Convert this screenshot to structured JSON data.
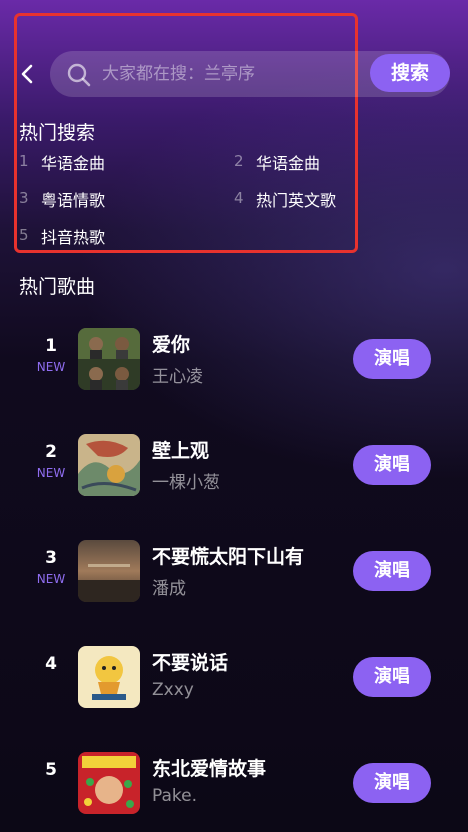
{
  "search": {
    "placeholder": "大家都在搜：兰亭序",
    "button_label": "搜索"
  },
  "hot_search": {
    "title": "热门搜索",
    "items": [
      {
        "rank": "1",
        "term": "华语金曲"
      },
      {
        "rank": "2",
        "term": "华语金曲"
      },
      {
        "rank": "3",
        "term": "粤语情歌"
      },
      {
        "rank": "4",
        "term": "热门英文歌"
      },
      {
        "rank": "5",
        "term": "抖音热歌"
      }
    ]
  },
  "hot_songs": {
    "title": "热门歌曲",
    "sing_label": "演唱",
    "items": [
      {
        "rank": "1",
        "badge": "NEW",
        "title": "爱你",
        "artist": "王心凌"
      },
      {
        "rank": "2",
        "badge": "NEW",
        "title": "壁上观",
        "artist": "一棵小葱"
      },
      {
        "rank": "3",
        "badge": "NEW",
        "title": "不要慌太阳下山有",
        "artist": "潘成"
      },
      {
        "rank": "4",
        "badge": "",
        "title": "不要说话",
        "artist": "Zxxy"
      },
      {
        "rank": "5",
        "badge": "",
        "title": "东北爱情故事",
        "artist": "Pake."
      }
    ]
  },
  "colors": {
    "accent": "#8c62f2",
    "new_badge": "#8f6df0",
    "highlight_box": "#e8322e"
  },
  "icons": [
    "back-arrow-icon",
    "search-icon"
  ]
}
